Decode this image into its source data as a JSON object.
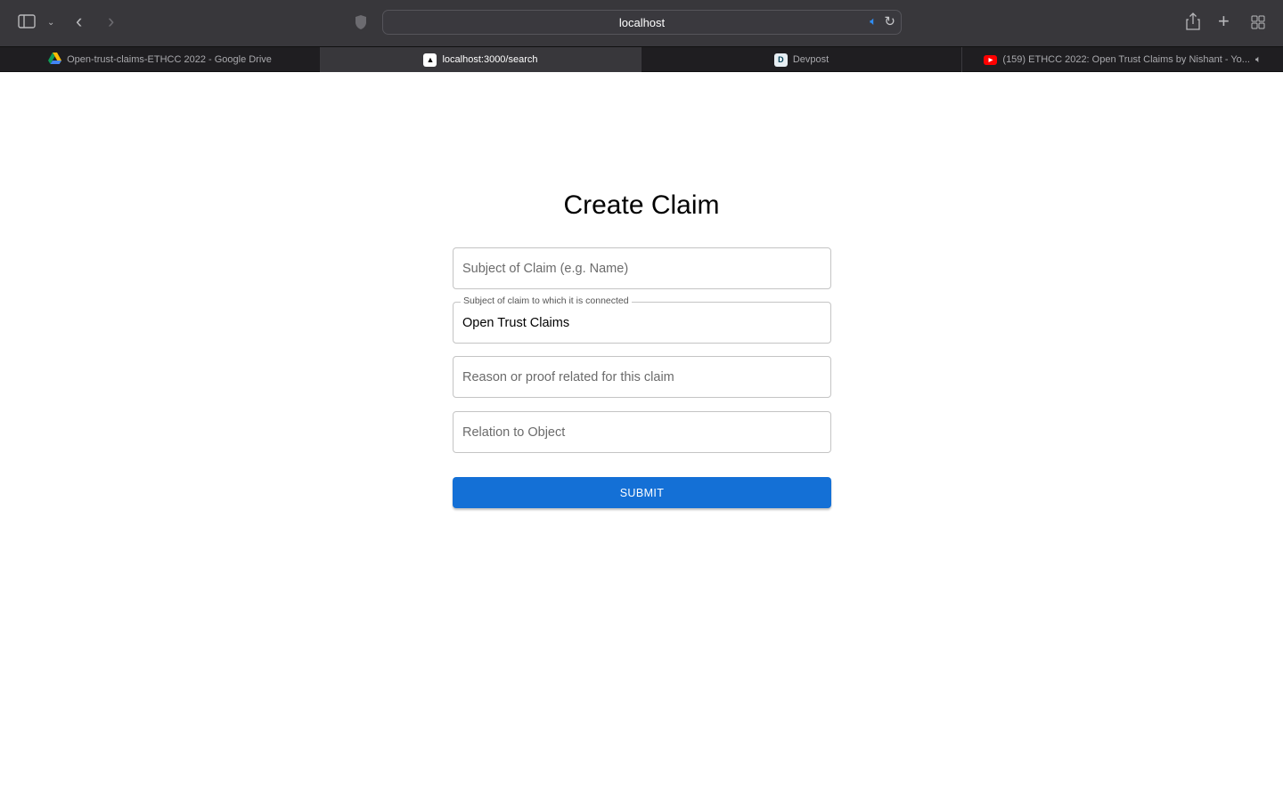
{
  "browser": {
    "url": "localhost",
    "tabs": [
      {
        "title": "Open-trust-claims-ETHCC 2022 - Google Drive",
        "icon": "google-drive-icon"
      },
      {
        "title": "localhost:3000/search",
        "icon": "app-icon",
        "active": true
      },
      {
        "title": "Devpost",
        "icon": "devpost-icon"
      },
      {
        "title": "(159) ETHCC 2022: Open Trust Claims by Nishant - Yo...",
        "icon": "youtube-icon"
      }
    ]
  },
  "page": {
    "title": "Create Claim",
    "fields": [
      {
        "placeholder": "Subject of Claim (e.g. Name)",
        "value": ""
      },
      {
        "label": "Subject of claim to which it is connected",
        "value": "Open Trust Claims"
      },
      {
        "placeholder": "Reason or proof related for this claim",
        "value": ""
      },
      {
        "placeholder": "Relation to Object",
        "value": ""
      }
    ],
    "submit_label": "SUBMIT"
  },
  "colors": {
    "accent": "#1470d6"
  }
}
